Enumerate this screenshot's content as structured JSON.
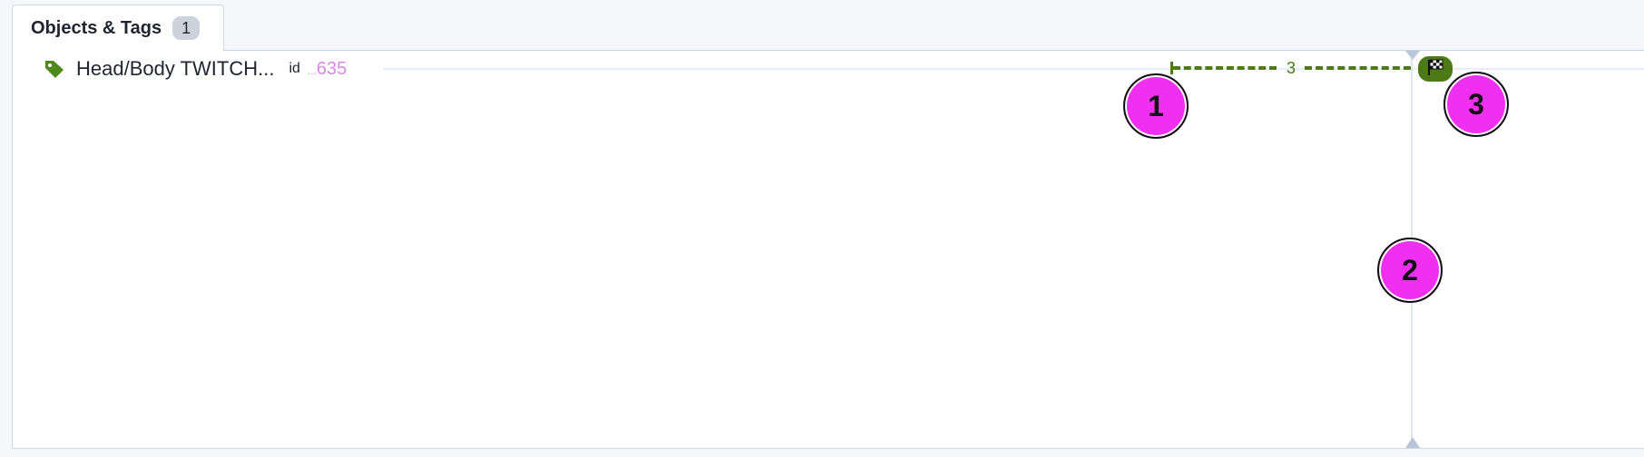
{
  "tab": {
    "label": "Objects & Tags",
    "count": "1"
  },
  "row": {
    "icon": "tag-icon",
    "label": "Head/Body TWITCH...",
    "id_label": "id",
    "id_ellipsis": "...",
    "id_value": "635"
  },
  "timeline": {
    "duration_label": "3",
    "end_icon": "checkered-flag-icon",
    "accent": "#4d7a16"
  },
  "markers": [
    "1",
    "2",
    "3"
  ],
  "colors": {
    "marker": "#f12ff1",
    "tag_icon": "#4d8a1a",
    "id_value": "#d58be0"
  }
}
